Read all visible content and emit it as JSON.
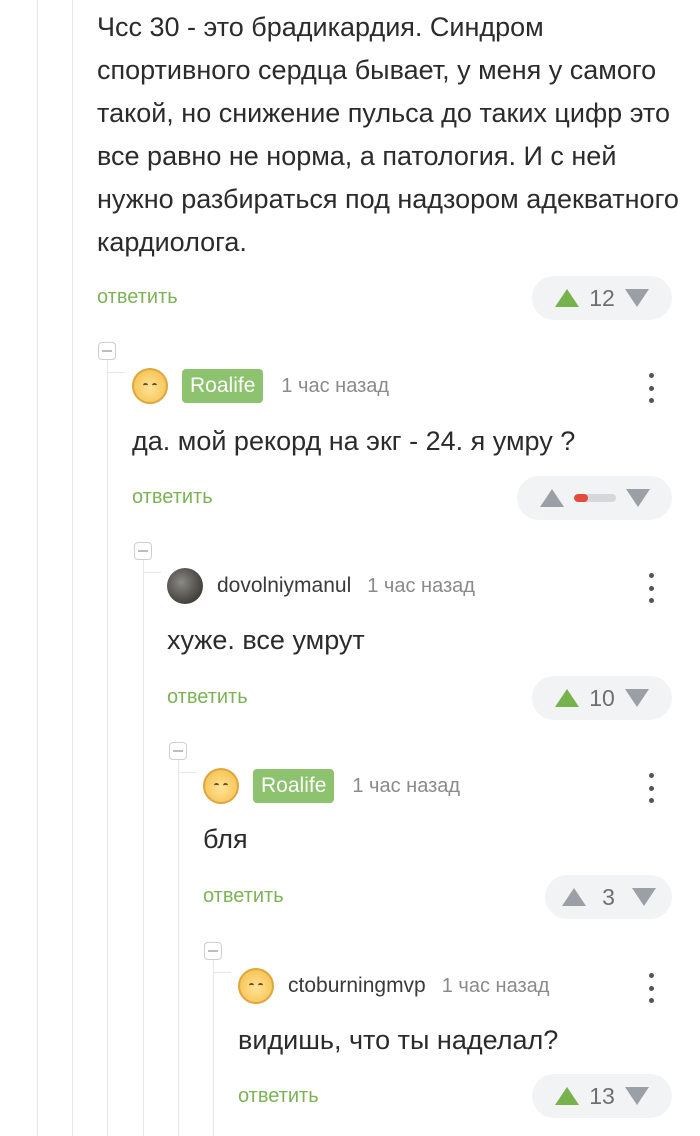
{
  "comments": [
    {
      "text": "Чсс 30 - это брадикардия. Синдром спортивного сердца бывает, у меня у самого такой, но снижение пульса до таких цифр это все равно не норма, а патология. И с ней нужно разбираться под надзором адекватного кардиолога.",
      "reply_label": "ответить",
      "votes": "12"
    },
    {
      "author": "Roalife",
      "time": "1 час назад",
      "text": "да. мой рекорд на экг - 24. я умру ?",
      "reply_label": "ответить",
      "rating_red_fraction": 0.35
    },
    {
      "author": "dovolniymanul",
      "time": "1 час назад",
      "text": "хуже. все умрут",
      "reply_label": "ответить",
      "votes": "10"
    },
    {
      "author": "Roalife",
      "time": "1 час назад",
      "text": "бля",
      "reply_label": "ответить",
      "votes": "3"
    },
    {
      "author": "ctoburningmvp",
      "time": "1 час назад",
      "text": "видишь, что ты наделал?",
      "reply_label": "ответить",
      "votes": "13"
    }
  ],
  "icons": {
    "upvote": "triangle-up-icon",
    "downvote": "triangle-down-icon",
    "menu": "kebab-icon",
    "collapse": "collapse-minus-icon"
  },
  "colors": {
    "accent": "#77b24e",
    "badge": "#8dc26e",
    "reply": "#7cb356",
    "negative": "#e44a3b"
  }
}
